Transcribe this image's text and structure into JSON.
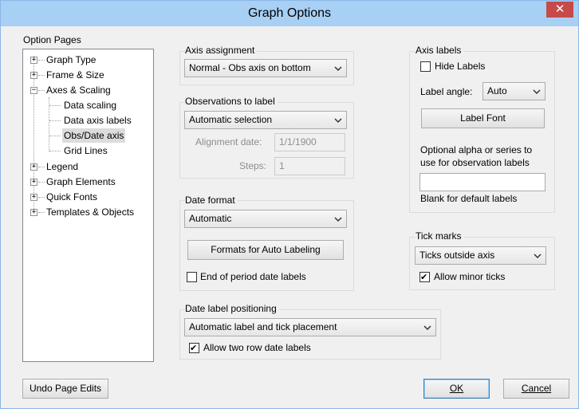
{
  "window": {
    "title": "Graph Options",
    "close_glyph": "✕"
  },
  "option_pages": {
    "label": "Option Pages",
    "items": [
      {
        "label": "Graph Type",
        "expander": "+"
      },
      {
        "label": "Frame & Size",
        "expander": "+"
      },
      {
        "label": "Axes & Scaling",
        "expander": "−"
      },
      {
        "label": "Data scaling"
      },
      {
        "label": "Data axis labels"
      },
      {
        "label": "Obs/Date axis",
        "selected": true
      },
      {
        "label": "Grid Lines"
      },
      {
        "label": "Legend",
        "expander": "+"
      },
      {
        "label": "Graph Elements",
        "expander": "+"
      },
      {
        "label": "Quick Fonts",
        "expander": "+"
      },
      {
        "label": "Templates & Objects",
        "expander": "+"
      }
    ]
  },
  "axis_assignment": {
    "title": "Axis assignment",
    "value": "Normal - Obs axis on bottom"
  },
  "observations": {
    "title": "Observations to label",
    "value": "Automatic selection",
    "alignment_label": "Alignment date:",
    "alignment_value": "1/1/1900",
    "steps_label": "Steps:",
    "steps_value": "1"
  },
  "date_format": {
    "title": "Date format",
    "value": "Automatic",
    "formats_button": "Formats for Auto Labeling",
    "end_of_period_label": "End of period date labels",
    "end_of_period_checked": false
  },
  "date_label_positioning": {
    "title": "Date label positioning",
    "value": "Automatic label and tick placement",
    "two_row_label": "Allow two row date labels",
    "two_row_checked": true
  },
  "axis_labels": {
    "title": "Axis labels",
    "hide_label": "Hide Labels",
    "hide_checked": false,
    "angle_label": "Label angle:",
    "angle_value": "Auto",
    "font_button": "Label Font",
    "optional_text_1": "Optional alpha or series to",
    "optional_text_2": "use for observation labels",
    "series_value": "",
    "blank_text": "Blank for default labels"
  },
  "tick_marks": {
    "title": "Tick marks",
    "value": "Ticks outside axis",
    "minor_label": "Allow minor ticks",
    "minor_checked": true
  },
  "footer": {
    "undo": "Undo Page Edits",
    "ok": "OK",
    "cancel": "Cancel"
  },
  "colors": {
    "titlebar": "#a8cff4",
    "close": "#c74a4a",
    "dialog": "#f0f0f0"
  }
}
